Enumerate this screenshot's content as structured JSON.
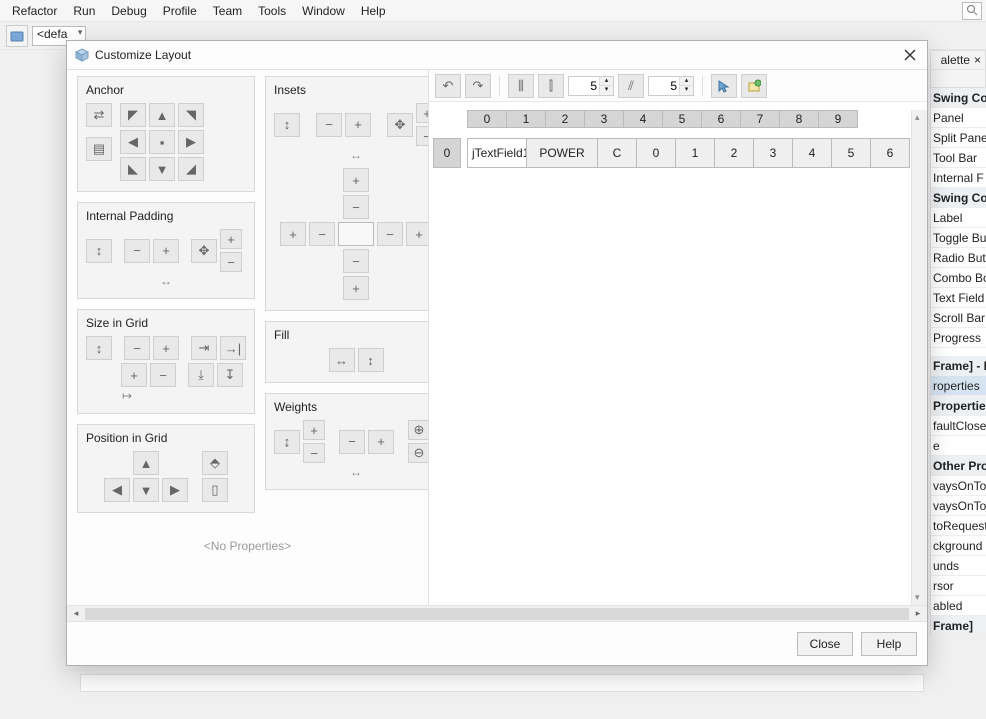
{
  "menu": {
    "items": [
      "Refactor",
      "Run",
      "Debug",
      "Profile",
      "Team",
      "Tools",
      "Window",
      "Help"
    ]
  },
  "toolbar": {
    "combo": "<defa"
  },
  "dialog": {
    "title": "Customize Layout",
    "panels": {
      "anchor": "Anchor",
      "internal_padding": "Internal Padding",
      "size_in_grid": "Size in Grid",
      "position_in_grid": "Position in Grid",
      "insets": "Insets",
      "fill": "Fill",
      "weights": "Weights"
    },
    "no_properties": "<No Properties>",
    "footer": {
      "close": "Close",
      "help": "Help"
    }
  },
  "preview": {
    "spinner1": "5",
    "spinner2": "5",
    "col_headers": [
      "0",
      "1",
      "2",
      "3",
      "4",
      "5",
      "6",
      "7",
      "8",
      "9"
    ],
    "row_header": "0",
    "cells": [
      "jTextField1",
      "POWER",
      "C",
      "0",
      "1",
      "2",
      "3",
      "4",
      "5",
      "6"
    ]
  },
  "palette": {
    "tab_label": "alette",
    "sections": [
      {
        "kind": "sec",
        "label": "Swing Co"
      },
      {
        "kind": "item",
        "label": "Panel"
      },
      {
        "kind": "item",
        "label": "Split Pane"
      },
      {
        "kind": "item",
        "label": "Tool Bar"
      },
      {
        "kind": "item",
        "label": "Internal F"
      },
      {
        "kind": "sec",
        "label": "Swing Co"
      },
      {
        "kind": "item",
        "label": "Label"
      },
      {
        "kind": "item",
        "label": "Toggle Bu"
      },
      {
        "kind": "item",
        "label": "Radio But"
      },
      {
        "kind": "item",
        "label": "Combo Bo"
      },
      {
        "kind": "item",
        "label": "Text Field"
      },
      {
        "kind": "item",
        "label": "Scroll Bar"
      },
      {
        "kind": "item",
        "label": "Progress"
      }
    ],
    "inspector": [
      {
        "kind": "sec",
        "label": "Frame] - P"
      },
      {
        "kind": "sel",
        "label": "roperties"
      },
      {
        "kind": "head",
        "label": "Properties"
      },
      {
        "kind": "item",
        "label": "faultClose"
      },
      {
        "kind": "item",
        "label": "e"
      },
      {
        "kind": "head",
        "label": "Other Prope"
      },
      {
        "kind": "item",
        "label": "vaysOnTop"
      },
      {
        "kind": "item",
        "label": "vaysOnTop"
      },
      {
        "kind": "item",
        "label": "toRequestF"
      },
      {
        "kind": "item",
        "label": "ckground"
      },
      {
        "kind": "item",
        "label": "unds"
      },
      {
        "kind": "item",
        "label": "rsor"
      },
      {
        "kind": "item",
        "label": "abled"
      },
      {
        "kind": "sec",
        "label": "Frame]"
      }
    ]
  }
}
